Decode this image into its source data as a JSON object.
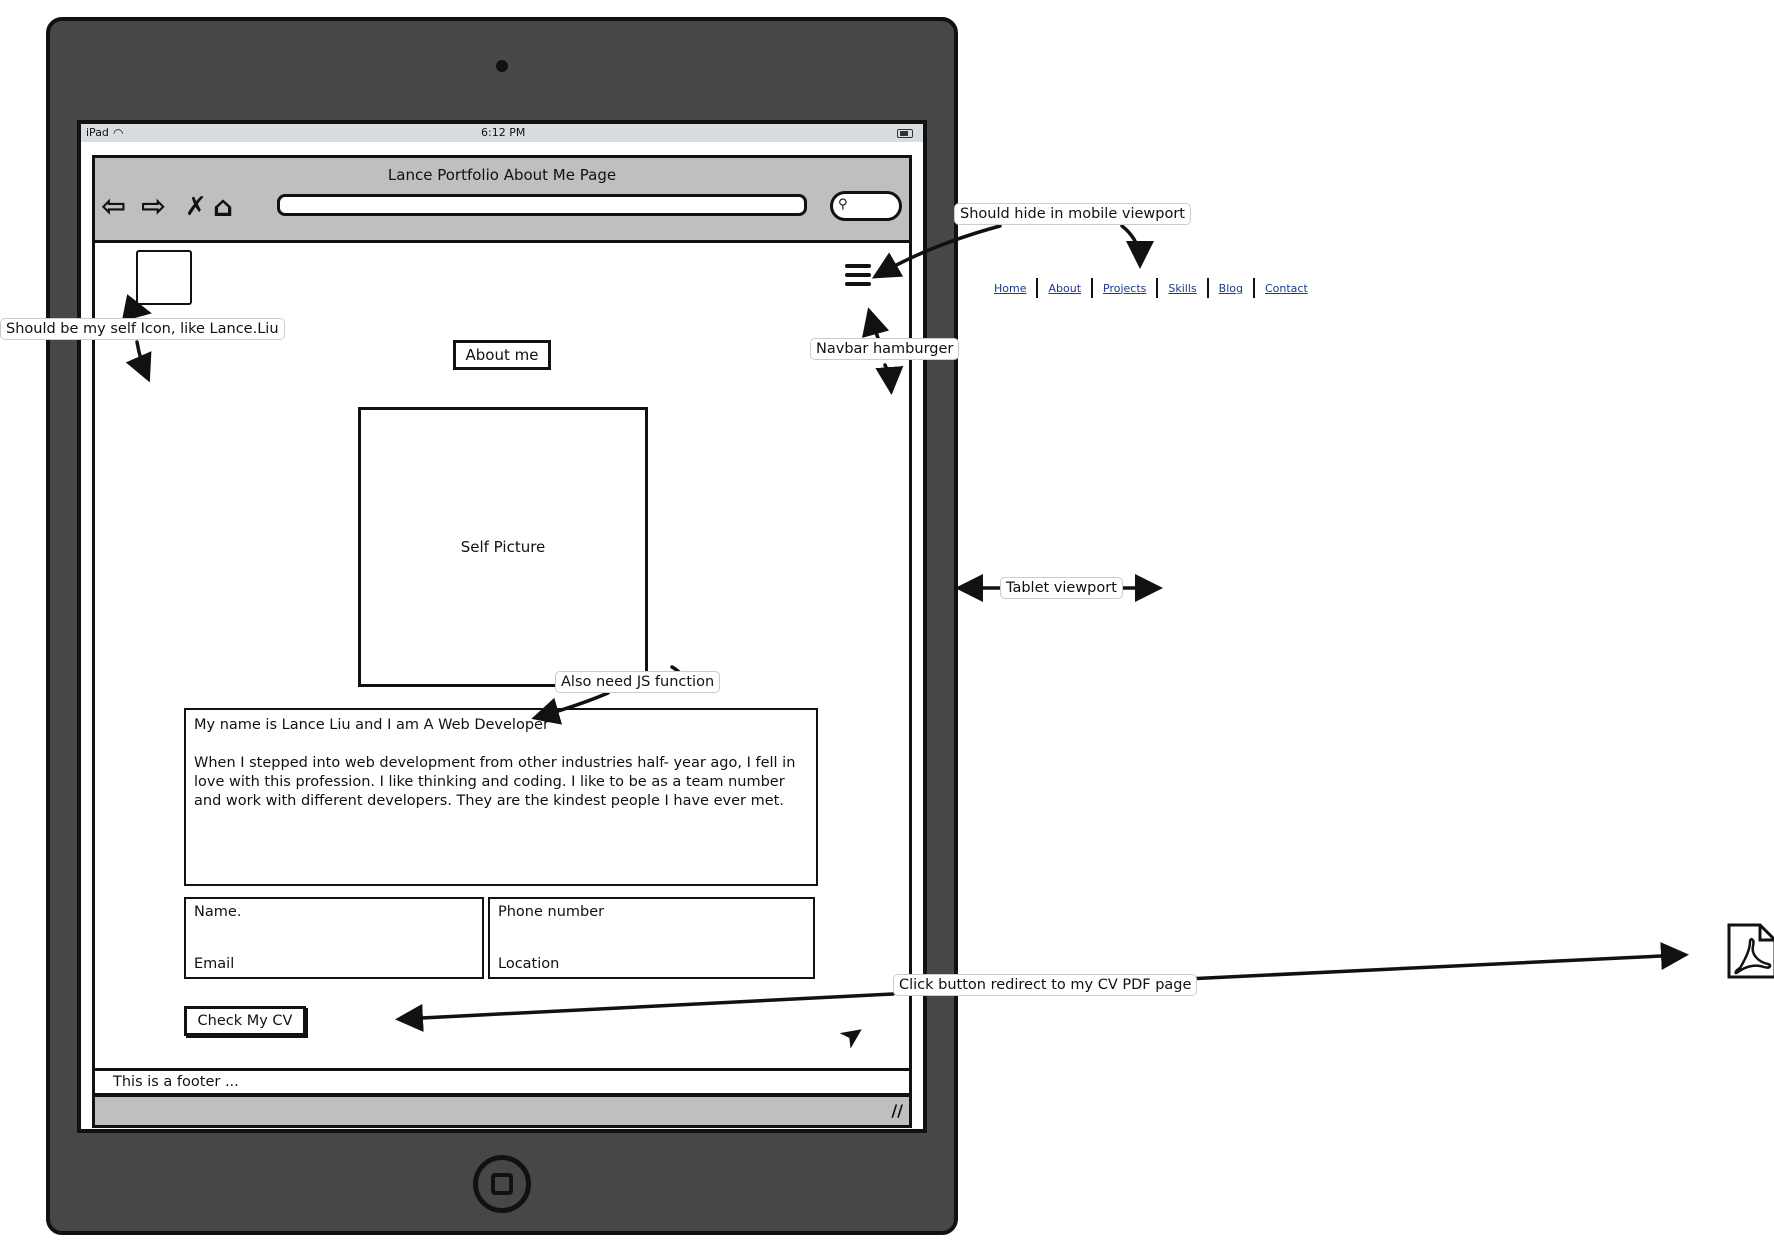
{
  "device": {
    "status_bar": {
      "carrier": "iPad",
      "time": "6:12 PM"
    }
  },
  "browser": {
    "title": "Lance Portfolio About Me Page",
    "icons": [
      "back-arrow-icon",
      "forward-arrow-icon",
      "close-icon",
      "home-icon",
      "search-icon"
    ]
  },
  "page": {
    "about_button": "About me",
    "self_picture_label": "Self Picture",
    "bio": {
      "title": "My name is Lance Liu and I am A Web Developer",
      "body": "When I stepped into web development from other industries half- year ago, I fell in love with this profession. I like thinking and coding. I like to be as a team number and work with different developers. They are the kindest people I have ever met."
    },
    "contact": {
      "name": "Name.",
      "email": "Email",
      "phone": "Phone number",
      "location": "Location"
    },
    "cv_button": "Check My CV",
    "footer": "This is a footer     ..."
  },
  "desktop_nav": {
    "links": [
      "Home",
      "About",
      "Projects",
      "Skills",
      "Blog",
      "Contact"
    ]
  },
  "annotations": {
    "self_icon": "Should be my self Icon, like Lance.Liu",
    "hide_mobile": "Should hide in mobile viewport",
    "hamburger": "Navbar hamburger",
    "tablet": "Tablet viewport",
    "js_function": "Also need JS function",
    "cv_redirect": "Click button redirect to my CV PDF page"
  },
  "colors": {
    "device_body": "#474747",
    "browser_bar": "#bfbfbf",
    "link": "#1a3a8a"
  }
}
